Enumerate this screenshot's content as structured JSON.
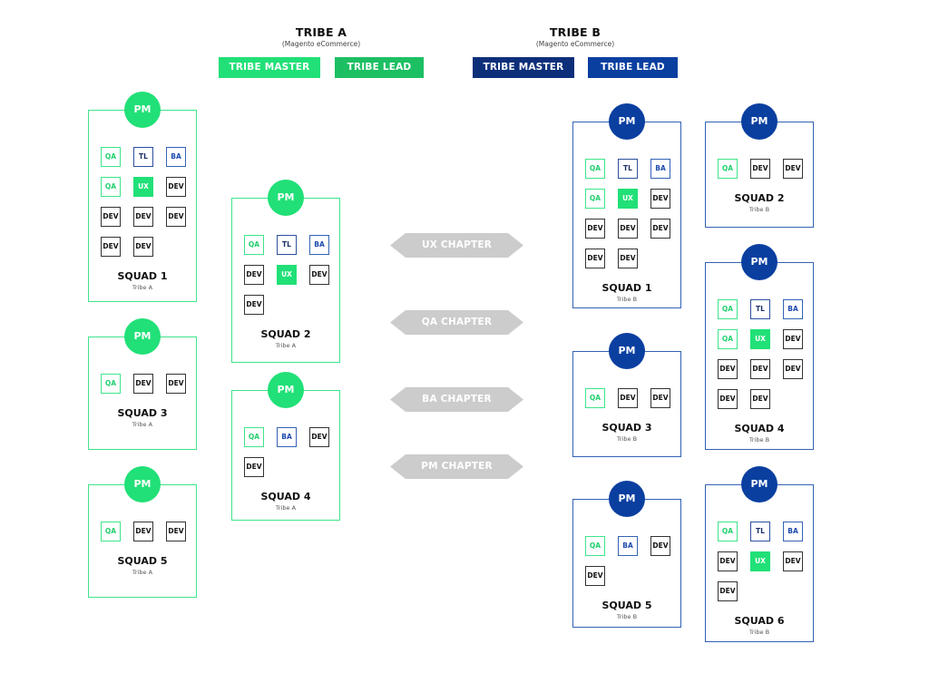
{
  "colors": {
    "tribe_a_master": "#21e077",
    "tribe_a_lead": "#1dbf63",
    "tribe_b_master": "#0d2f7a",
    "tribe_b_lead": "#0a3fa0",
    "chapter_arrow": "#cccccc"
  },
  "tribes": [
    {
      "title": "TRIBE A",
      "subtitle": "(Magento eCommerce)",
      "master_label": "TRIBE MASTER",
      "lead_label": "TRIBE LEAD",
      "squads": [
        {
          "pm": "PM",
          "name": "SQUAD 1",
          "tribe": "Tribe A",
          "roles": [
            "QA",
            "TL",
            "BA",
            "QA",
            "UX",
            "DEV",
            "DEV",
            "DEV",
            "DEV",
            "DEV",
            "DEV"
          ]
        },
        {
          "pm": "PM",
          "name": "SQUAD 2",
          "tribe": "Tribe A",
          "roles": [
            "QA",
            "TL",
            "BA",
            "DEV",
            "UX",
            "DEV",
            "DEV"
          ]
        },
        {
          "pm": "PM",
          "name": "SQUAD 3",
          "tribe": "Tribe A",
          "roles": [
            "QA",
            "DEV",
            "DEV"
          ]
        },
        {
          "pm": "PM",
          "name": "SQUAD 4",
          "tribe": "Tribe A",
          "roles": [
            "QA",
            "BA",
            "DEV",
            "DEV"
          ]
        },
        {
          "pm": "PM",
          "name": "SQUAD 5",
          "tribe": "Tribe A",
          "roles": [
            "QA",
            "DEV",
            "DEV"
          ]
        }
      ]
    },
    {
      "title": "TRIBE B",
      "subtitle": "(Magento eCommerce)",
      "master_label": "TRIBE MASTER",
      "lead_label": "TRIBE LEAD",
      "squads": [
        {
          "pm": "PM",
          "name": "SQUAD 1",
          "tribe": "Tribe B",
          "roles": [
            "QA",
            "TL",
            "BA",
            "QA",
            "UX",
            "DEV",
            "DEV",
            "DEV",
            "DEV",
            "DEV",
            "DEV"
          ]
        },
        {
          "pm": "PM",
          "name": "SQUAD 2",
          "tribe": "Tribe B",
          "roles": [
            "QA",
            "DEV",
            "DEV"
          ]
        },
        {
          "pm": "PM",
          "name": "SQUAD 3",
          "tribe": "Tribe B",
          "roles": [
            "QA",
            "DEV",
            "DEV"
          ]
        },
        {
          "pm": "PM",
          "name": "SQUAD 4",
          "tribe": "Tribe B",
          "roles": [
            "QA",
            "TL",
            "BA",
            "QA",
            "UX",
            "DEV",
            "DEV",
            "DEV",
            "DEV",
            "DEV",
            "DEV"
          ]
        },
        {
          "pm": "PM",
          "name": "SQUAD 5",
          "tribe": "Tribe B",
          "roles": [
            "QA",
            "BA",
            "DEV",
            "DEV"
          ]
        },
        {
          "pm": "PM",
          "name": "SQUAD 6",
          "tribe": "Tribe B",
          "roles": [
            "QA",
            "TL",
            "BA",
            "DEV",
            "UX",
            "DEV",
            "DEV"
          ]
        }
      ]
    }
  ],
  "chapters": [
    {
      "label": "UX CHAPTER"
    },
    {
      "label": "QA CHAPTER"
    },
    {
      "label": "BA CHAPTER"
    },
    {
      "label": "PM CHAPTER"
    }
  ]
}
